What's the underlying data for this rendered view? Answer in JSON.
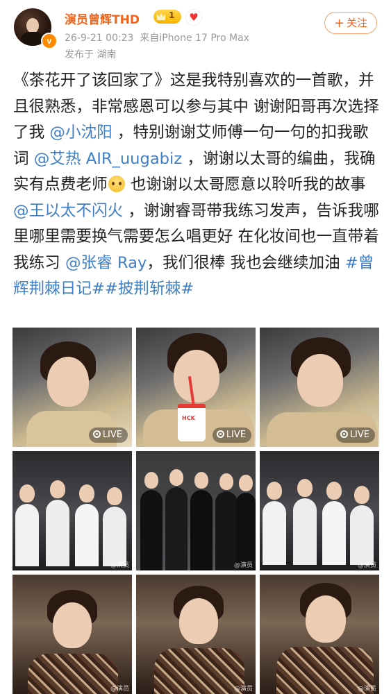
{
  "header": {
    "username": "演员曾辉THD",
    "level_badge": "1",
    "verified_badge": "v",
    "timestamp": "26-9-21 00:23",
    "device": "来自iPhone 17 Pro Max",
    "location": "发布于 湖南",
    "follow_label": "关注",
    "follow_icon": "plus-icon",
    "accent_color": "#f0641e"
  },
  "post": {
    "seg1": "《茶花开了该回家了》这是我特别喜欢的一首歌，并且很熟悉，非常感恩可以参与其中 谢谢阳哥再次选择了我 ",
    "mention1": "@小沈阳",
    "seg2": " ，特别谢谢艾师傅一句一句的扣我歌词 ",
    "mention2": "@艾热 AIR_uugabiz",
    "seg3": " ，谢谢以太哥的编曲，我确实有点费老师",
    "seg4": " 也谢谢以太哥愿意以聆听我的故事 ",
    "mention3": "@王以太不闪火",
    "seg5": " ，谢谢睿哥带我练习发声，告诉我哪里哪里需要换气需要怎么唱更好 在化妆间也一直带着我练习 ",
    "mention4": "@张睿 Ray",
    "seg6": "，我们很棒 我也会继续加油 ",
    "tag1": "#曾辉荆棘日记#",
    "tag2": "#披荆斩棘#",
    "link_color": "#3f7fc7"
  },
  "photos": {
    "live_label": "LIVE",
    "watermark": "@演员",
    "cup_text": "HCK"
  }
}
